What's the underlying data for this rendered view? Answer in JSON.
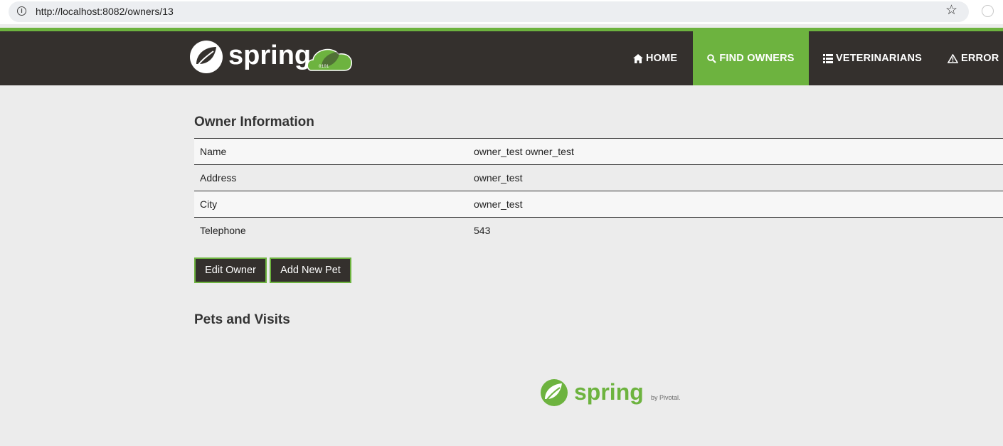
{
  "browser": {
    "url": "http://localhost:8082/owners/13",
    "info_icon": "info-icon",
    "bookmark_icon": "star-icon"
  },
  "brand": {
    "logo_text": "spring",
    "accent_color": "#6db33f",
    "navbar_color": "#34302d"
  },
  "nav": {
    "home": "HOME",
    "find_owners": "FIND OWNERS",
    "veterinarians": "VETERINARIANS",
    "error": "ERROR",
    "active": "FIND OWNERS"
  },
  "owner": {
    "section_title": "Owner Information",
    "rows": [
      {
        "label": "Name",
        "value": "owner_test owner_test"
      },
      {
        "label": "Address",
        "value": "owner_test"
      },
      {
        "label": "City",
        "value": "owner_test"
      },
      {
        "label": "Telephone",
        "value": "543"
      }
    ]
  },
  "actions": {
    "edit_owner": "Edit Owner",
    "add_new_pet": "Add New Pet"
  },
  "pets": {
    "section_title": "Pets and Visits"
  },
  "footer": {
    "logo_text": "spring",
    "by_text": "by Pivotal."
  }
}
